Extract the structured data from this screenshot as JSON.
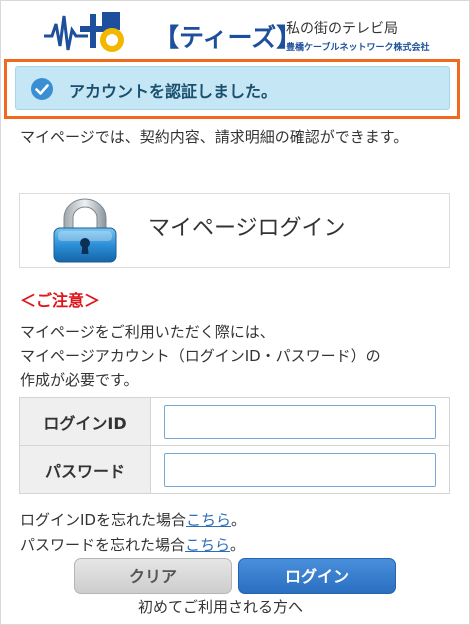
{
  "header": {
    "brand": "【ティーズ】",
    "tagline": "私の街のテレビ局",
    "company": "豊橋ケーブルネットワーク株式会社",
    "logo_icon": "tees-logo-mark"
  },
  "alert": {
    "message": "アカウントを認証しました。",
    "icon": "check-circle-icon"
  },
  "intro": "マイページでは、契約内容、請求明細の確認ができます。",
  "mypage": {
    "title": "マイページログイン",
    "icon": "lock-icon"
  },
  "notice": {
    "title": "＜ご注意＞",
    "line1": "マイページをご利用いただく際には、",
    "line2": "マイページアカウント（ログインID・パスワード）の",
    "line3": "作成が必要です。"
  },
  "form": {
    "login_id_label": "ログインID",
    "login_id_value": "",
    "password_label": "パスワード",
    "password_value": ""
  },
  "help": {
    "forgot_id_text": "ログインIDを忘れた場合",
    "forgot_password_text": "パスワードを忘れた場合",
    "link_text": "こちら",
    "period": "。"
  },
  "buttons": {
    "clear": "クリア",
    "login": "ログイン"
  },
  "first_time_link": "初めてご利用される方へ",
  "colors": {
    "alert_bg": "#c5e6f4",
    "highlight_outline": "#ef6a1f",
    "notice_red": "#e0141a",
    "login_button": "#2a6fc0",
    "brand_blue": "#1d4f9c"
  }
}
